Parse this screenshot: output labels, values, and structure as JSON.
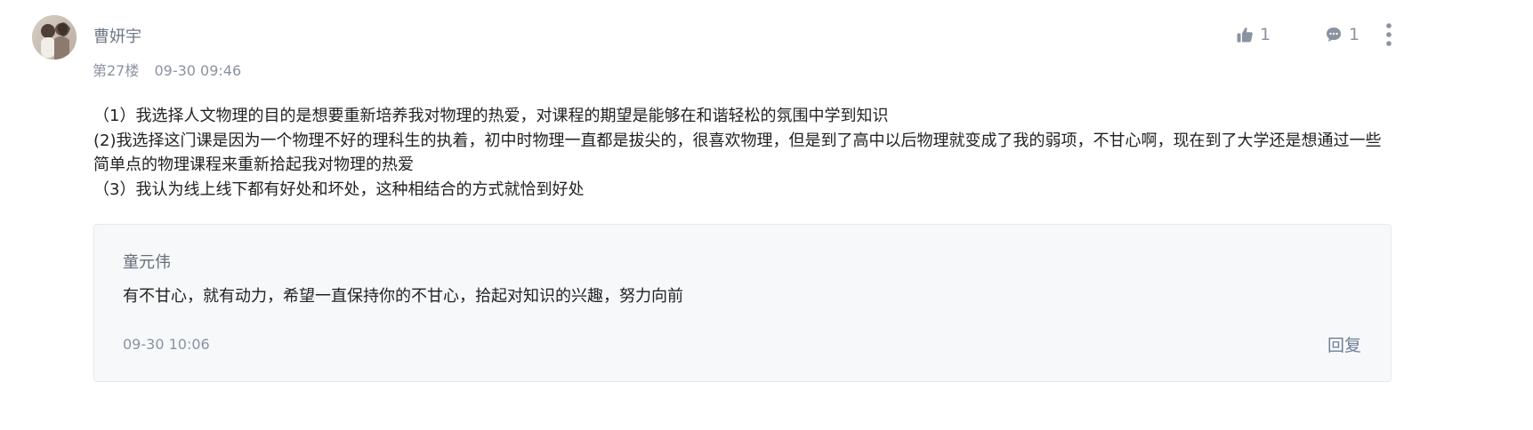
{
  "post": {
    "author": "曹妍宇",
    "floor": "第27楼",
    "time": "09-30 09:46",
    "actions": {
      "like_count": "1",
      "comment_count": "1",
      "like_icon": "thumb-up-icon",
      "comment_icon": "comment-icon",
      "more_icon": "more-vertical-icon"
    },
    "content": [
      "（1）我选择人文物理的目的是想要重新培养我对物理的热爱，对课程的期望是能够在和谐轻松的氛围中学到知识",
      "(2)我选择这门课是因为一个物理不好的理科生的执着，初中时物理一直都是拔尖的，很喜欢物理，但是到了高中以后物理就变成了我的弱项，不甘心啊，现在到了大学还是想通过一些简单点的物理课程来重新拾起我对物理的热爱",
      "（3）我认为线上线下都有好处和坏处，这种相结合的方式就恰到好处"
    ]
  },
  "reply": {
    "author": "童元伟",
    "content": "有不甘心，就有动力，希望一直保持你的不甘心，拾起对知识的兴趣，努力向前",
    "time": "09-30 10:06",
    "reply_label": "回复"
  },
  "colors": {
    "muted_text": "#8a93a0",
    "body_text": "#222222",
    "reply_background": "#f7f8fa",
    "reply_link": "#6e7f99"
  }
}
